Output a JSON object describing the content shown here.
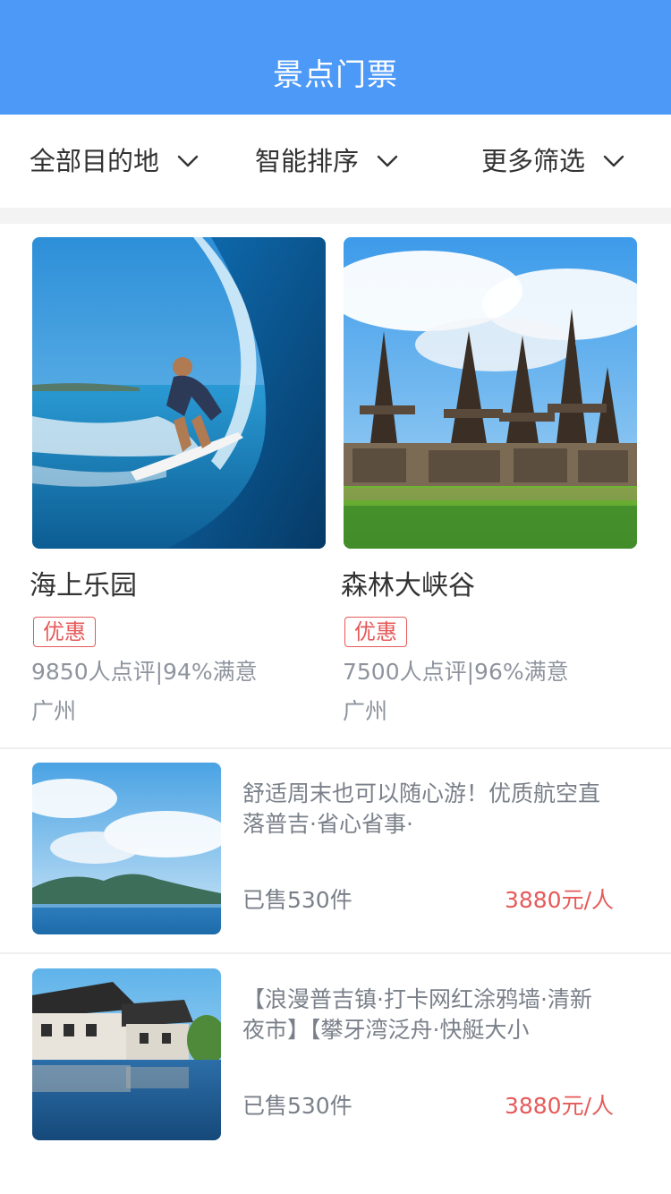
{
  "header": {
    "title": "景点门票"
  },
  "filters": [
    {
      "label": "全部目的地"
    },
    {
      "label": "智能排序"
    },
    {
      "label": "更多筛选"
    }
  ],
  "grid_items": [
    {
      "name": "海上乐园",
      "badge": "优惠",
      "stats": "9850人点评|94%满意",
      "city": "广州",
      "image": "surfer-wave-photo"
    },
    {
      "name": "森林大峡谷",
      "badge": "优惠",
      "stats": "7500人点评|96%满意",
      "city": "广州",
      "image": "temple-pagodas-photo"
    }
  ],
  "list_items": [
    {
      "description": "舒适周末也可以随心游！优质航空直落普吉·省心省事·",
      "sold": "已售530件",
      "price": "3880元/人",
      "image": "sea-island-photo"
    },
    {
      "description": "【浪漫普吉镇·打卡网红涂鸦墙·清新夜市】【攀牙湾泛舟·快艇大小",
      "sold": "已售530件",
      "price": "3880元/人",
      "image": "water-town-photo"
    }
  ],
  "colors": {
    "header_bg": "#4d99f8",
    "accent_red": "#e65a5a",
    "secondary_text": "#8e949e"
  }
}
